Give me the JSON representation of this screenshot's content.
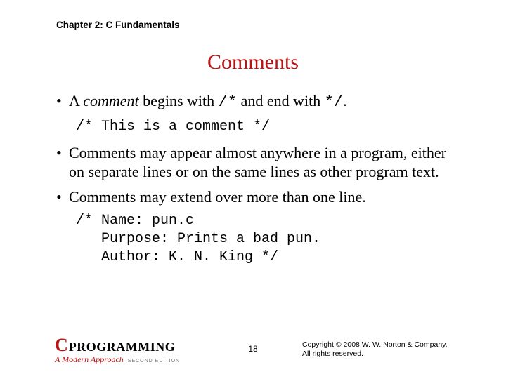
{
  "chapter": "Chapter 2: C Fundamentals",
  "title": "Comments",
  "bullets": {
    "b1_pre": "A ",
    "b1_term": "comment",
    "b1_mid": " begins with ",
    "b1_code1": "/*",
    "b1_mid2": " and end with ",
    "b1_code2": "*/",
    "b1_end": ".",
    "code1": "/* This is a comment */",
    "b2": "Comments may appear almost anywhere in a program, either on separate lines or on the same lines as other program text.",
    "b3": "Comments may extend over more than one line.",
    "code2": "/* Name: pun.c\n   Purpose: Prints a bad pun.\n   Author: K. N. King */"
  },
  "footer": {
    "logo_c": "C",
    "logo_prog": "PROGRAMMING",
    "logo_approach": "A Modern Approach",
    "logo_edition": "SECOND EDITION",
    "page": "18",
    "copyright_l1": "Copyright © 2008 W. W. Norton & Company.",
    "copyright_l2": "All rights reserved."
  }
}
